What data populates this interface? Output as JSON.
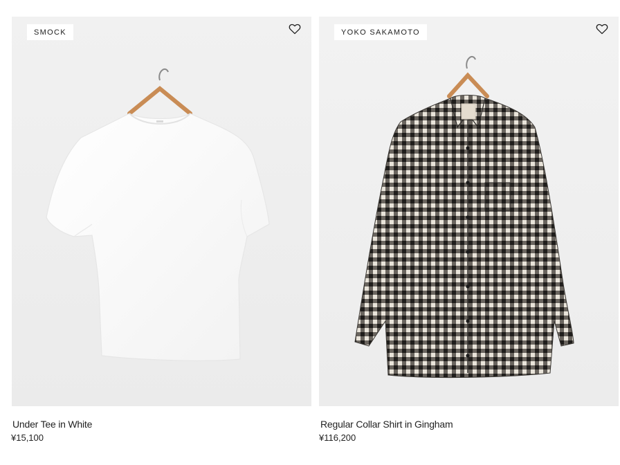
{
  "products": [
    {
      "brand": "SMOCK",
      "name": "Under Tee in White",
      "price": "¥15,100",
      "image": "white-tshirt-on-hanger",
      "wishlist_icon": "heart-icon"
    },
    {
      "brand": "YOKO SAKAMOTO",
      "name": "Regular Collar Shirt in Gingham",
      "price": "¥116,200",
      "image": "gingham-shirt-on-hanger",
      "wishlist_icon": "heart-icon"
    }
  ],
  "colors": {
    "text": "#222222",
    "image_background": "#efefef",
    "badge_background": "#ffffff"
  }
}
